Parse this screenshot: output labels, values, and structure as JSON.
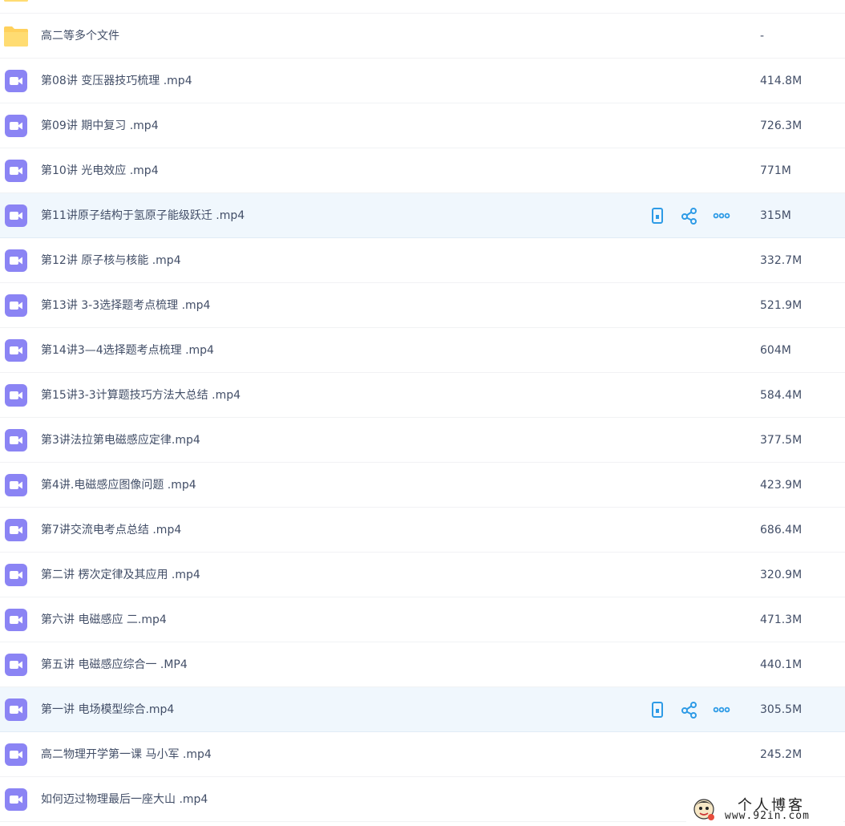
{
  "colors": {
    "video_icon": "#8b84f4",
    "folder_icon": "#ffd15c",
    "action_icon": "#2e9be6",
    "hover_row": "#f0f7fd",
    "text": "#424e67"
  },
  "file_list": {
    "rows": [
      {
        "type": "folder",
        "name": "",
        "size": ""
      },
      {
        "type": "folder",
        "name": "高二等多个文件",
        "size": "-"
      },
      {
        "type": "video",
        "name": "第08讲 变压器技巧梳理 .mp4",
        "size": "414.8M"
      },
      {
        "type": "video",
        "name": "第09讲 期中复习 .mp4",
        "size": "726.3M"
      },
      {
        "type": "video",
        "name": "第10讲 光电效应 .mp4",
        "size": "771M"
      },
      {
        "type": "video",
        "name": "第11讲原子结构于氢原子能级跃迁 .mp4",
        "size": "315M",
        "hover": true
      },
      {
        "type": "video",
        "name": "第12讲 原子核与核能 .mp4",
        "size": "332.7M"
      },
      {
        "type": "video",
        "name": "第13讲 3-3选择题考点梳理 .mp4",
        "size": "521.9M"
      },
      {
        "type": "video",
        "name": "第14讲3—4选择题考点梳理 .mp4",
        "size": "604M"
      },
      {
        "type": "video",
        "name": "第15讲3-3计算题技巧方法大总结 .mp4",
        "size": "584.4M"
      },
      {
        "type": "video",
        "name": "第3讲法拉第电磁感应定律.mp4",
        "size": "377.5M"
      },
      {
        "type": "video",
        "name": "第4讲.电磁感应图像问题 .mp4",
        "size": "423.9M"
      },
      {
        "type": "video",
        "name": "第7讲交流电考点总结 .mp4",
        "size": "686.4M"
      },
      {
        "type": "video",
        "name": "第二讲 楞次定律及其应用 .mp4",
        "size": "320.9M"
      },
      {
        "type": "video",
        "name": "第六讲 电磁感应 二.mp4",
        "size": "471.3M"
      },
      {
        "type": "video",
        "name": "第五讲 电磁感应综合一 .MP4",
        "size": "440.1M"
      },
      {
        "type": "video",
        "name": "第一讲 电场模型综合.mp4",
        "size": "305.5M",
        "hover": true
      },
      {
        "type": "video",
        "name": "高二物理开学第一课 马小军 .mp4",
        "size": "245.2M"
      },
      {
        "type": "video",
        "name": "如何迈过物理最后一座大山 .mp4",
        "size": ""
      }
    ],
    "row_actions": [
      "phone-icon",
      "share-icon",
      "more-icon"
    ]
  },
  "watermark": {
    "title": "个人博客",
    "url": "www.92in.com"
  }
}
